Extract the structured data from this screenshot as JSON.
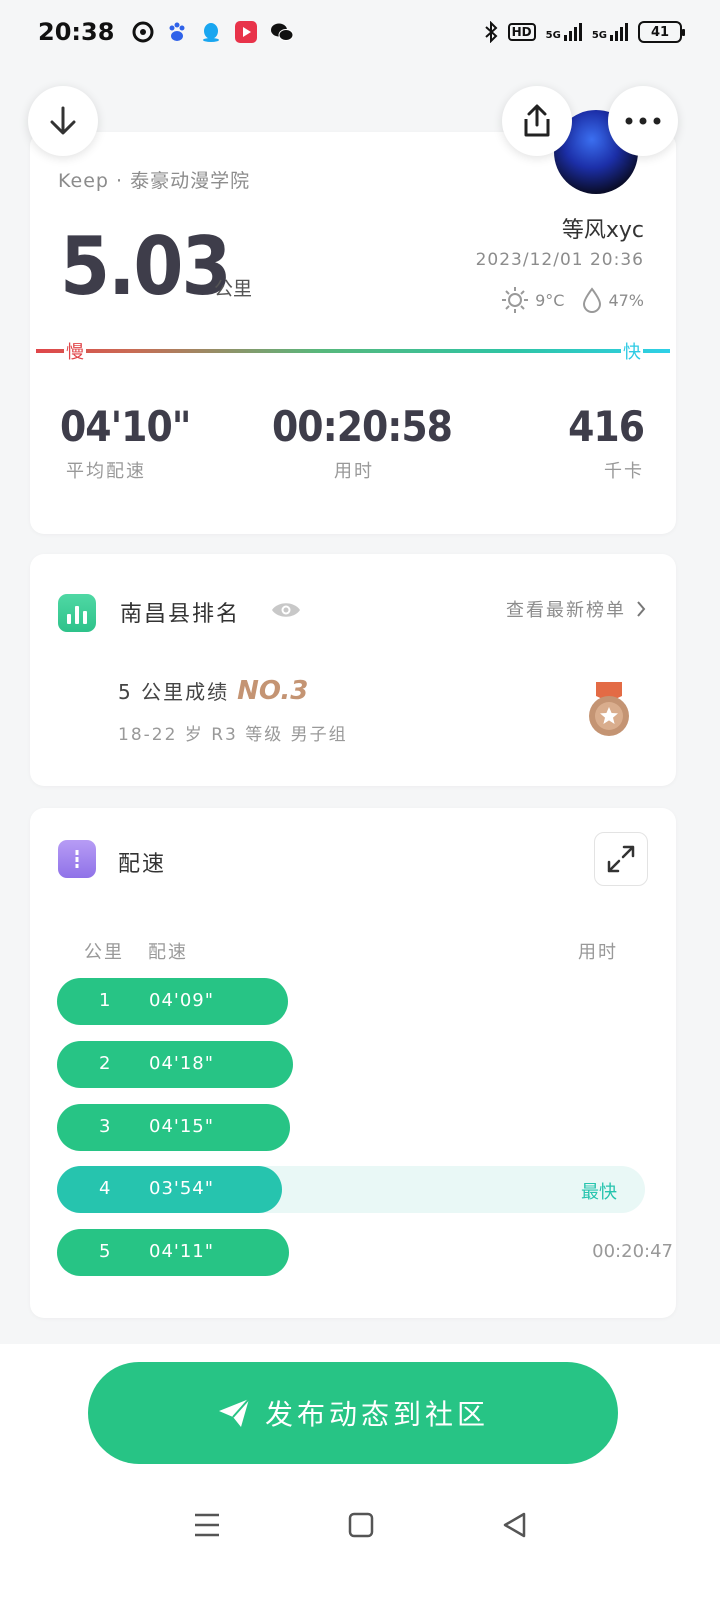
{
  "status_bar": {
    "time": "20:38",
    "network_hd": "HD",
    "net1": "5G",
    "net2": "5G",
    "battery": "41"
  },
  "summary": {
    "place": "Keep · 泰豪动漫学院",
    "distance": "5.03",
    "distance_unit": "公里",
    "username": "等风xyc",
    "datetime": "2023/12/01 20:36",
    "temperature": "9°C",
    "humidity": "47%",
    "slow_label": "慢",
    "fast_label": "快",
    "stats": [
      {
        "value": "04'10\"",
        "label": "平均配速"
      },
      {
        "value": "00:20:58",
        "label": "用时"
      },
      {
        "value": "416",
        "label": "千卡"
      }
    ]
  },
  "ranking": {
    "title": "南昌县排名",
    "link": "查看最新榜单",
    "score_label": "5 公里成绩",
    "rank": "NO.3",
    "group": "18-22 岁 R3 等级 男子组"
  },
  "pace": {
    "title": "配速",
    "headers": {
      "km": "公里",
      "pace": "配速",
      "time": "用时"
    },
    "rows": [
      {
        "km": "1",
        "pace": "04'09\"",
        "fill_ratio": 0.393,
        "extra": ""
      },
      {
        "km": "2",
        "pace": "04'18\"",
        "fill_ratio": 0.401,
        "extra": ""
      },
      {
        "km": "3",
        "pace": "04'15\"",
        "fill_ratio": 0.396,
        "extra": ""
      },
      {
        "km": "4",
        "pace": "03'54\"",
        "fill_ratio": 0.383,
        "extra": "最快",
        "fastest": true
      },
      {
        "km": "5",
        "pace": "04'11\"",
        "fill_ratio": 0.394,
        "extra": "00:20:47"
      }
    ]
  },
  "publish_button": "发布动态到社区",
  "colors": {
    "brand_green": "#27c485",
    "fastest_teal": "#26c4ae",
    "medal_bronze": "#c49473"
  }
}
